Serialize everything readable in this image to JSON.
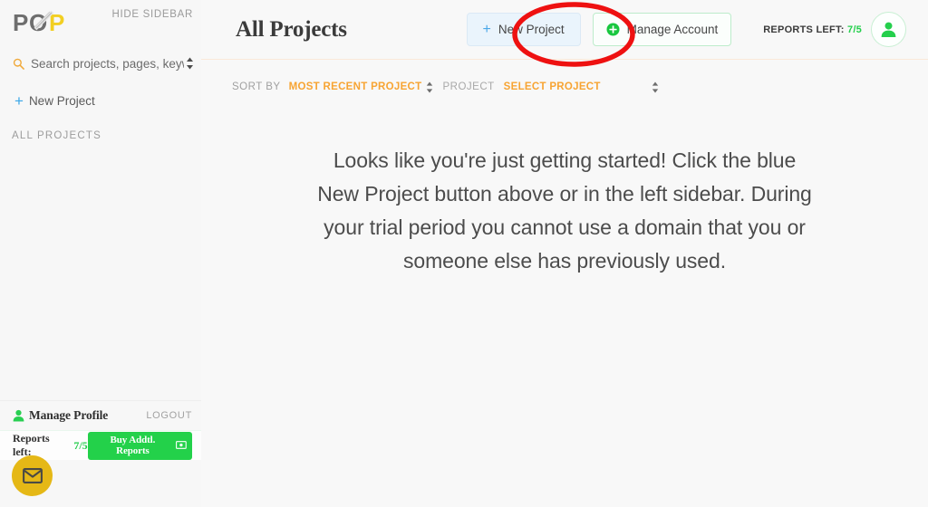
{
  "sidebar": {
    "logo_alt": "POP",
    "hide_sidebar_label": "HIDE SIDEBAR",
    "search": {
      "placeholder": "Search projects, pages, keywords...",
      "value": "",
      "icon": "search-icon",
      "sort_toggle_icon": "up-down-arrows-icon"
    },
    "new_project_label": "New Project",
    "new_project_icon": "plus-icon",
    "section_label": "ALL PROJECTS",
    "footer": {
      "manage_profile_label": "Manage Profile",
      "manage_profile_icon": "person-icon",
      "logout_label": "LOGOUT",
      "reports_left_label": "Reports left:",
      "reports_left_value": "7/5",
      "buy_reports_label": "Buy Addtl. Reports",
      "buy_reports_icon": "money-bill-icon"
    },
    "chat_button_icon": "envelope-icon"
  },
  "header": {
    "title": "All Projects",
    "new_project_button": {
      "label": "New Project",
      "icon": "plus-icon"
    },
    "manage_account_button": {
      "label": "Manage Account",
      "icon": "circle-plus-icon"
    },
    "reports_left_label": "REPORTS LEFT:",
    "reports_left_value": "7/5",
    "avatar_icon": "person-avatar-icon"
  },
  "sort_bar": {
    "sort_by_label": "SORT BY",
    "sort_value": "MOST RECENT PROJECT",
    "sort_caret_icon": "up-down-arrows-icon",
    "project_label": "PROJECT",
    "select_project_label": "SELECT PROJECT",
    "project_caret_icon": "up-down-arrows-icon"
  },
  "main": {
    "empty_state_message": "Looks like you're just getting started! Click the blue New Project button above or in the left sidebar.\nDuring your trial period you cannot use a domain that you or someone else has previously used."
  },
  "annotation": {
    "shape": "ellipse",
    "color": "#ee1111",
    "target": "new-project-button"
  },
  "colors": {
    "accent_orange": "#f7a433",
    "accent_blue": "#4aa8e8",
    "accent_green": "#23d14a",
    "logo_yellow": "#f2cf22",
    "chat_yellow": "#e5b816",
    "annotation_red": "#ee1111"
  }
}
